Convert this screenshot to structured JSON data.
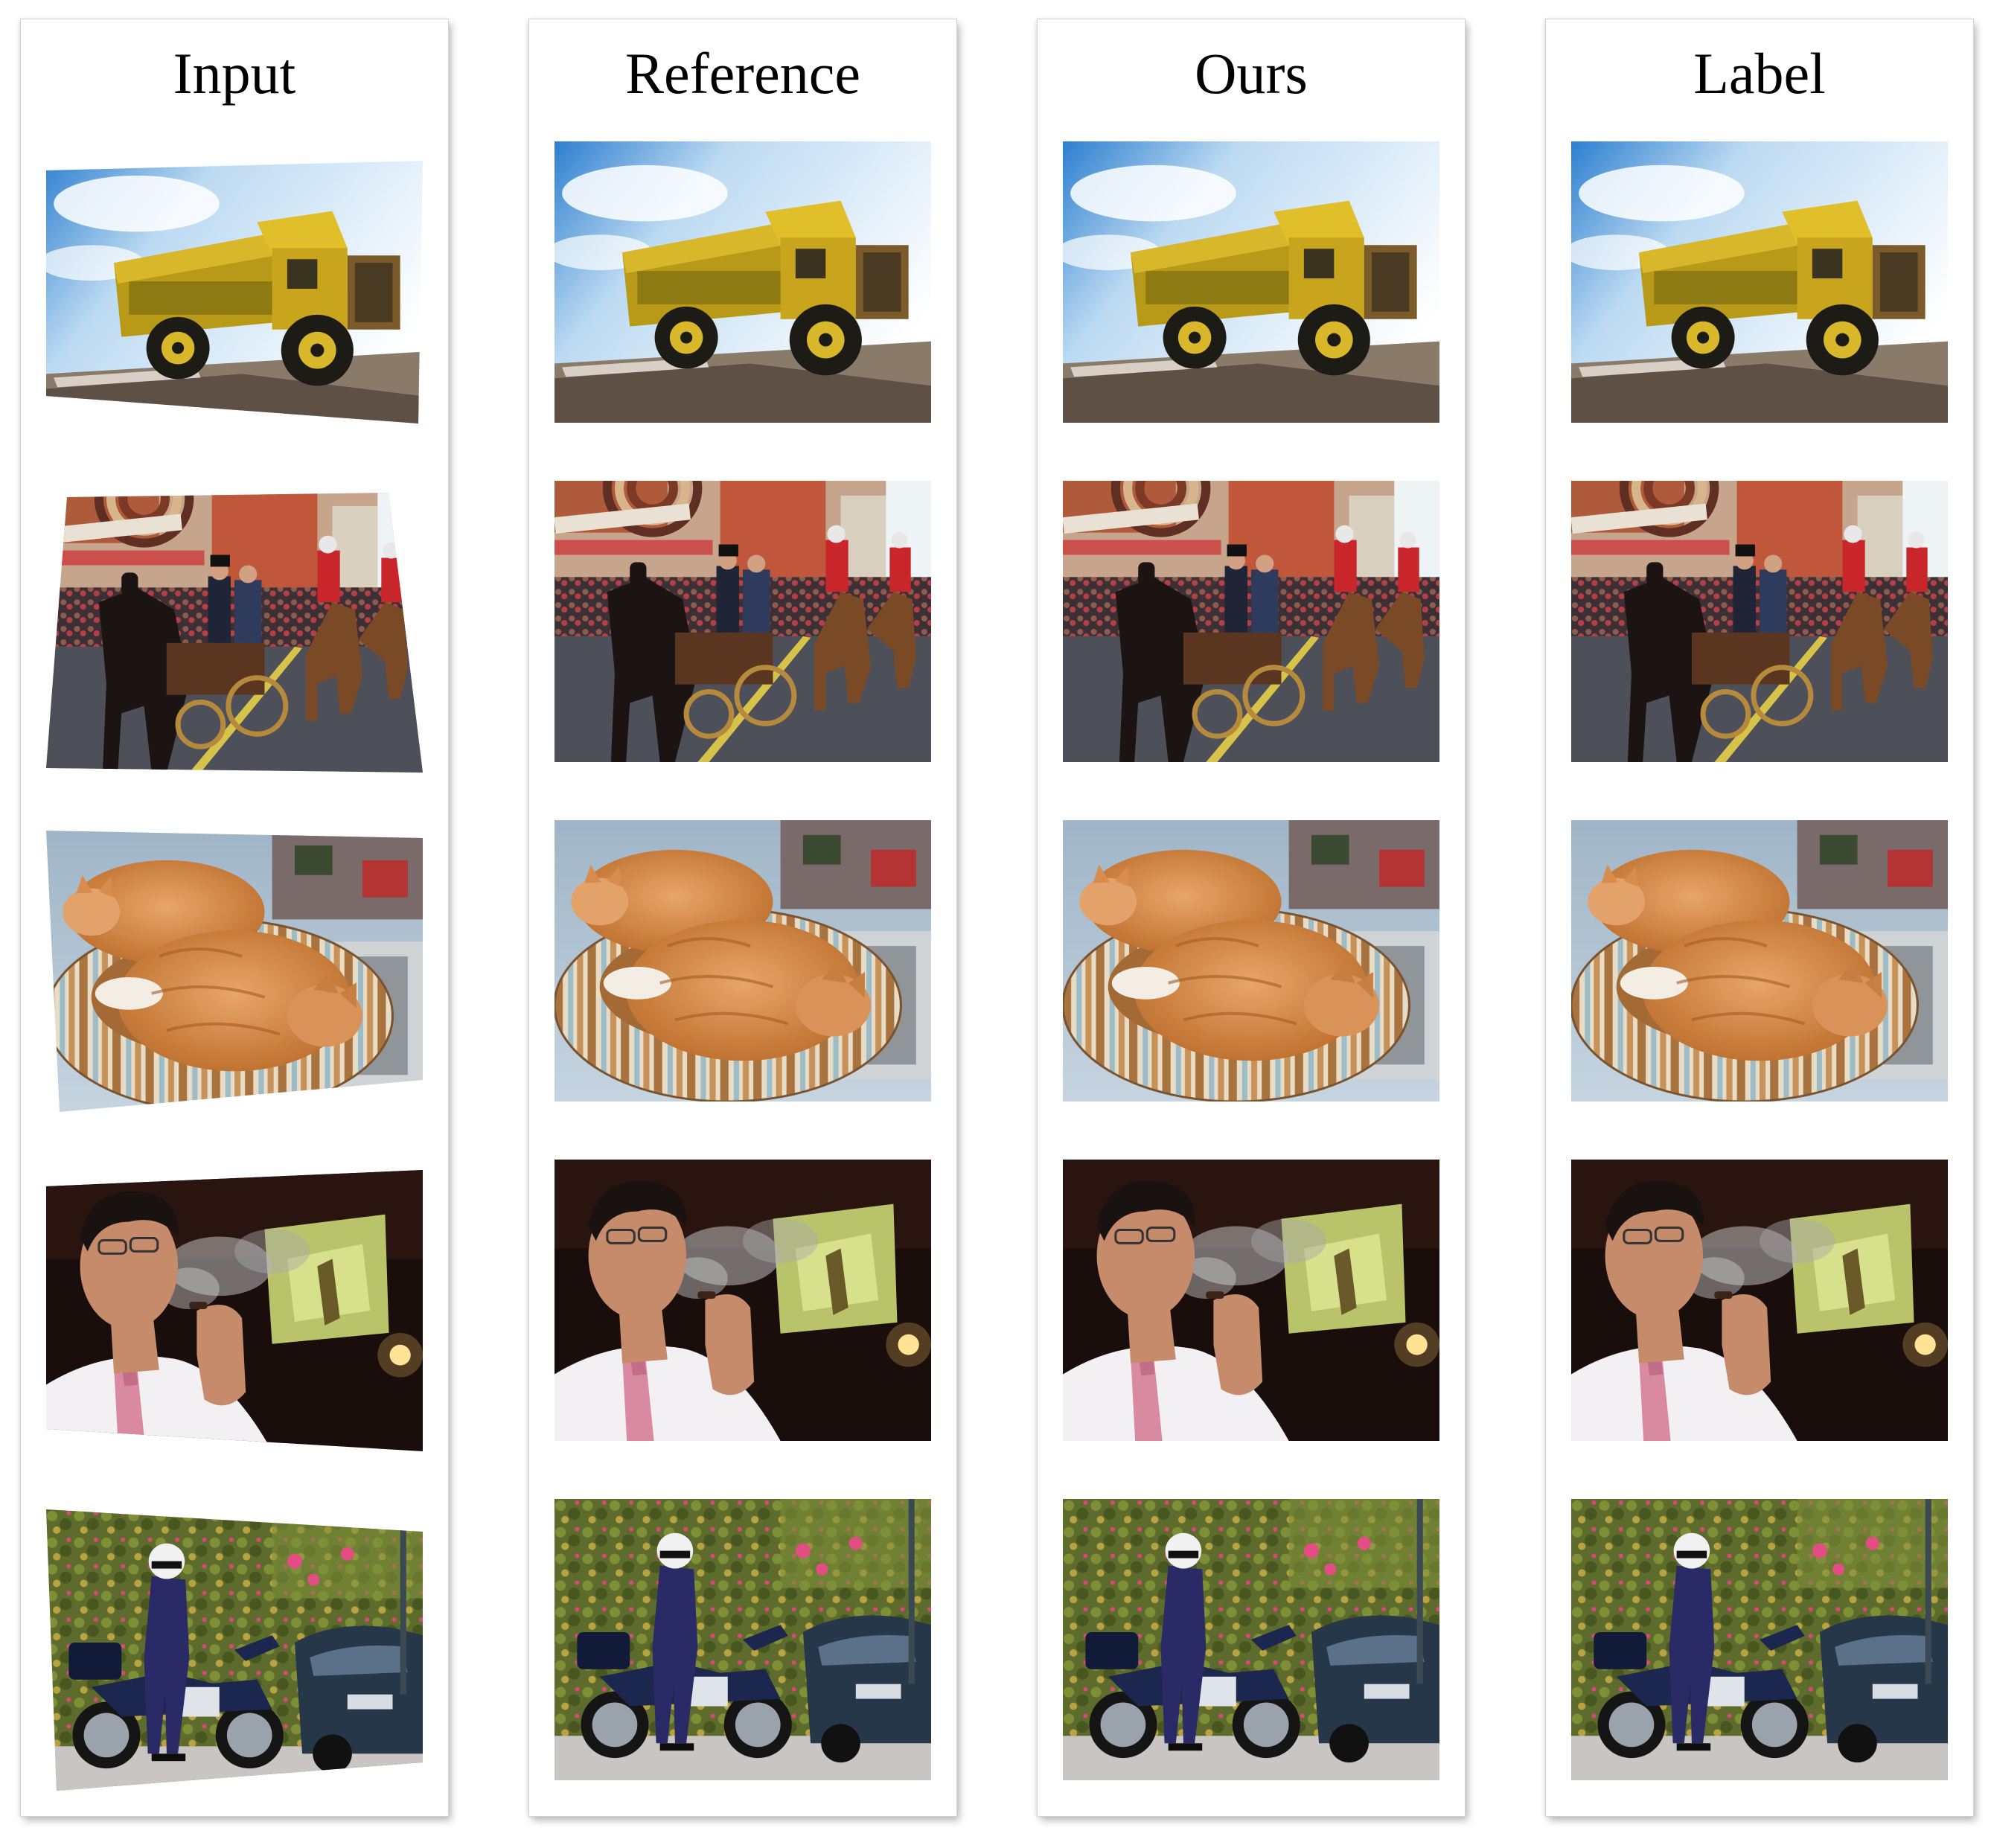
{
  "columns": [
    {
      "id": "input",
      "title": "Input",
      "warped": true
    },
    {
      "id": "reference",
      "title": "Reference",
      "warped": false
    },
    {
      "id": "ours",
      "title": "Ours",
      "warped": false
    },
    {
      "id": "label",
      "title": "Label",
      "warped": false
    }
  ],
  "rows": [
    {
      "id": "truck",
      "scene": "yellow dump truck on rocky ground under blue sky"
    },
    {
      "id": "parade",
      "scene": "horse-drawn carriage in a street parade"
    },
    {
      "id": "cats",
      "scene": "two orange cats sleeping in a striped pet bed"
    },
    {
      "id": "smoker",
      "scene": "man in white shirt and pink tie exhaling smoke"
    },
    {
      "id": "police",
      "scene": "police officer standing beside motorcycle"
    }
  ]
}
